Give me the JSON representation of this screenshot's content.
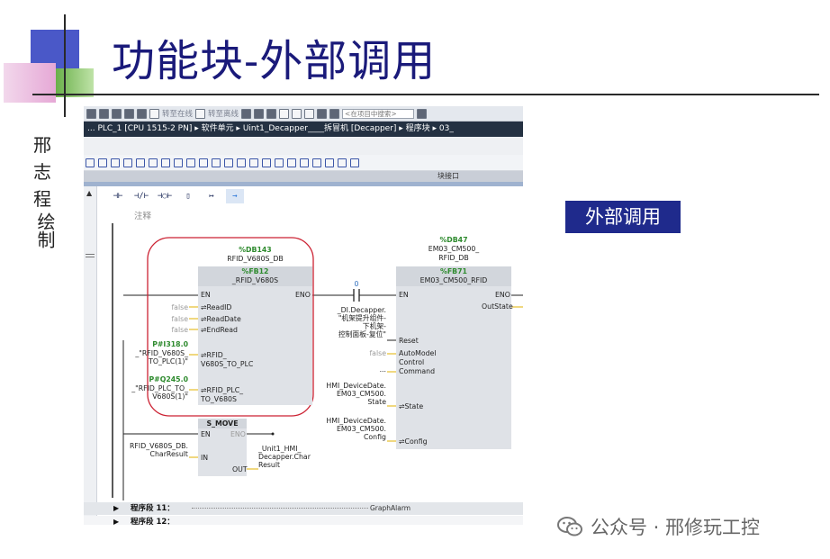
{
  "slide": {
    "title": "功能块-外部调用",
    "author_vertical": [
      "邢",
      "志",
      "程",
      "绘制"
    ],
    "callout_label": "外部调用",
    "footer_text": "公众号 · 邢修玩工控"
  },
  "tia": {
    "toolbar": {
      "go_online": "转至在线",
      "go_offline": "转至离线",
      "search_placeholder": "<在项目中搜索>"
    },
    "breadcrumb": "... PLC_1 [CPU 1515-2 PN] ▸ 软件单元 ▸ Uint1_Decapper____拆冒机 [Decapper] ▸ 程序块 ▸ 03_",
    "block_interface_label": "块接口",
    "ladder_tools": [
      "⊣⊢",
      "⊣/⊢",
      "⊣○⊢",
      "▯",
      "↦",
      "→"
    ],
    "comment": "注释",
    "fb12": {
      "db_addr": "%DB143",
      "db_name": "RFID_V680S_DB",
      "fb_addr": "%FB12",
      "fb_name": "_RFID_V680S",
      "en": "EN",
      "eno": "ENO",
      "pins": [
        "ReadID",
        "ReadDate",
        "EndRead",
        "RFID_",
        "V680S_TO_PLC",
        "RFID_PLC_",
        "TO_V680S"
      ],
      "false_vals": [
        "false",
        "false",
        "false"
      ],
      "in1_addr": "P#I318.0",
      "in1_name_a": "_\"RFID_V680S_",
      "in1_name_b": "TO_PLC(1)\"",
      "in2_addr": "P#Q245.0",
      "in2_name_a": "_\"RFID_PLC_TO_",
      "in2_name_b": "V680S(1)\""
    },
    "contact_value": "0",
    "fb71": {
      "db_addr": "%DB47",
      "db_name_a": "EM03_CM500_",
      "db_name_b": "RFID_DB",
      "fb_addr": "%FB71",
      "fb_name": "EM03_CM500_RFID",
      "en": "EN",
      "eno": "ENO",
      "out_state": "OutState",
      "pins": [
        "Reset",
        "AutoModel",
        "Control",
        "Command",
        "State",
        "Config"
      ],
      "reset_src": [
        "_DI.Decapper.",
        "\"机架提升组件-",
        "下机架-",
        "控制面板-复位\""
      ],
      "auto_src": "false",
      "command_src": "...",
      "state_src": [
        "HMI_DeviceDate.",
        "EM03_CM500.",
        "State"
      ],
      "config_src": [
        "HMI_DeviceDate.",
        "EM03_CM500.",
        "Config"
      ]
    },
    "smove": {
      "name": "S_MOVE",
      "en": "EN",
      "eno": "ENO",
      "in": "IN",
      "out": "OUT",
      "in_src_a": "RFID_V680S_DB.",
      "in_src_b": "CharResult",
      "out_dst": [
        "_Unit1_HMI_",
        "Decapper.Char",
        "Result"
      ]
    },
    "segment11": {
      "label": "程序段 11：",
      "name": "GraphAlarm"
    },
    "segment12": {
      "label": "程序段 12："
    }
  },
  "colors": {
    "title": "#1a1a7a",
    "callout_bg": "#1f2a8c",
    "highlight_ring": "#cc2233",
    "breadcrumb_bg": "#243142"
  }
}
